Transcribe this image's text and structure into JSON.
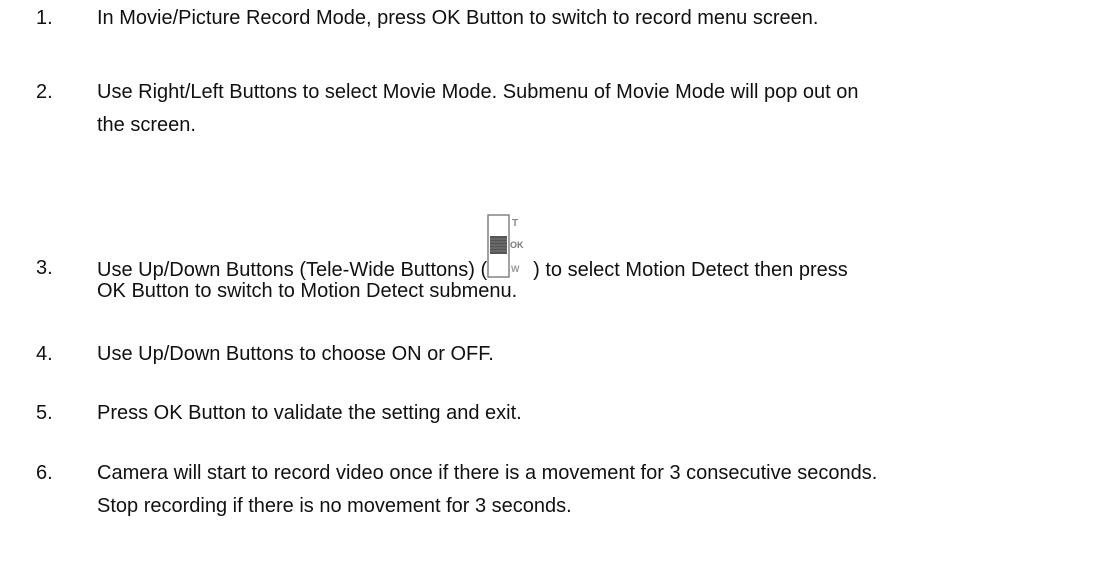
{
  "steps": [
    {
      "number": "1.",
      "lines": [
        "In Movie/Picture Record Mode, press OK Button to switch to record menu screen."
      ]
    },
    {
      "number": "2.",
      "lines": [
        "Use Right/Left Buttons to select Movie Mode. Submenu of Movie Mode will pop out on",
        "the screen."
      ]
    },
    {
      "number": "3.",
      "line1_before_icon": "Use Up/Down Buttons (Tele-Wide Buttons) (",
      "line1_after_icon": ")    to select Motion Detect then press",
      "line2": "OK Button to switch to Motion Detect submenu.",
      "icon": {
        "name": "tele-wide-slider-icon",
        "labels": [
          "T",
          "OK",
          "W"
        ]
      }
    },
    {
      "number": "4.",
      "lines": [
        "Use Up/Down Buttons to choose ON or OFF."
      ]
    },
    {
      "number": "5.",
      "lines": [
        "Press OK Button to validate the setting and exit."
      ]
    },
    {
      "number": "6.",
      "lines": [
        "Camera will start to record video once if there is a movement for 3 consecutive seconds.",
        "Stop recording if there is no movement for 3 seconds."
      ]
    }
  ]
}
